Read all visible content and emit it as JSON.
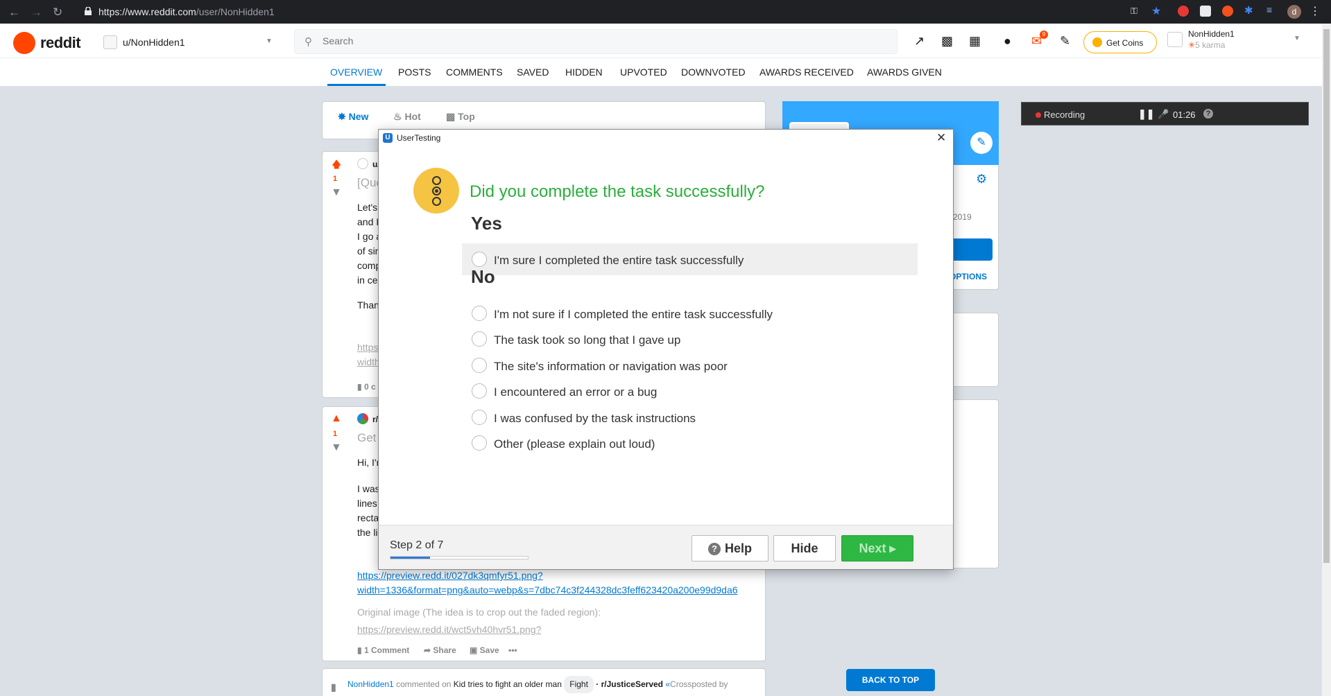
{
  "browser": {
    "url_host": "https://www.reddit.com",
    "url_path": "/user/NonHidden1"
  },
  "header": {
    "logo_text": "reddit",
    "user_dropdown": "u/NonHidden1",
    "search_placeholder": "Search",
    "coins_label": "Get Coins",
    "username": "NonHidden1",
    "karma": "5 karma",
    "mail_badge": "9"
  },
  "tabs": [
    "OVERVIEW",
    "POSTS",
    "COMMENTS",
    "SAVED",
    "HIDDEN",
    "UPVOTED",
    "DOWNVOTED",
    "AWARDS RECEIVED",
    "AWARDS GIVEN"
  ],
  "sort": {
    "new": "New",
    "hot": "Hot",
    "top": "Top"
  },
  "post1": {
    "score": "1",
    "author_stub": "u/",
    "title_stub": "[Que",
    "lines": [
      "Let's",
      "and I",
      "I go a",
      "of sin",
      "comp",
      "in cer",
      "Than"
    ],
    "link1": "https",
    "link2": "width",
    "comments_stub": "0 c"
  },
  "post2": {
    "score": "1",
    "sub_stub": "r/",
    "title_stub": "Get",
    "lines": [
      "Hi, I'r",
      "I was",
      "lines.",
      "recta",
      "the li"
    ],
    "link_a": "https://preview.redd.it/027dk3qmfyr51.png?",
    "link_b": "width=1336&format=png&auto=webp&s=7dbc74c3f244328dc3feff623420a200e99d9da6",
    "orig": "Original image (The idea is to crop out the faded region):",
    "orig_link": "https://preview.redd.it/wct5vh40hvr51.png?",
    "comments": "1 Comment",
    "share": "Share",
    "save": "Save",
    "more": "•••"
  },
  "post3": {
    "user": "NonHidden1",
    "commented_on": "commented on",
    "title": "Kid tries to fight an older man",
    "flair": "Fight",
    "sub": "r/JusticeServed",
    "crosspost": "Crossposted by"
  },
  "recording": {
    "label": "Recording",
    "time": "01:26"
  },
  "modal": {
    "app_title": "UserTesting",
    "question": "Did you complete the task successfully?",
    "yes_heading": "Yes",
    "no_heading": "No",
    "yes_options": [
      "I'm sure I completed the entire task successfully"
    ],
    "no_options": [
      "I'm not sure if I completed the entire task successfully",
      "The task took so long that I gave up",
      "The site's information or navigation was poor",
      "I encountered an error or a bug",
      "I was confused by the task instructions",
      "Other (please explain out loud)"
    ],
    "step_label": "Step 2 of 7",
    "step_progress": 0.29,
    "help": "Help",
    "hide": "Hide",
    "next": "Next"
  },
  "sidebar": {
    "year_stub": "2019",
    "options_stub": "OPTIONS",
    "back_to_top": "BACK TO TOP"
  },
  "colors": {
    "reddit_orange": "#ff4500",
    "reddit_blue": "#0079d3",
    "question_green": "#2aae3b",
    "next_green": "#2eb843",
    "icon_yellow": "#f5c443"
  }
}
